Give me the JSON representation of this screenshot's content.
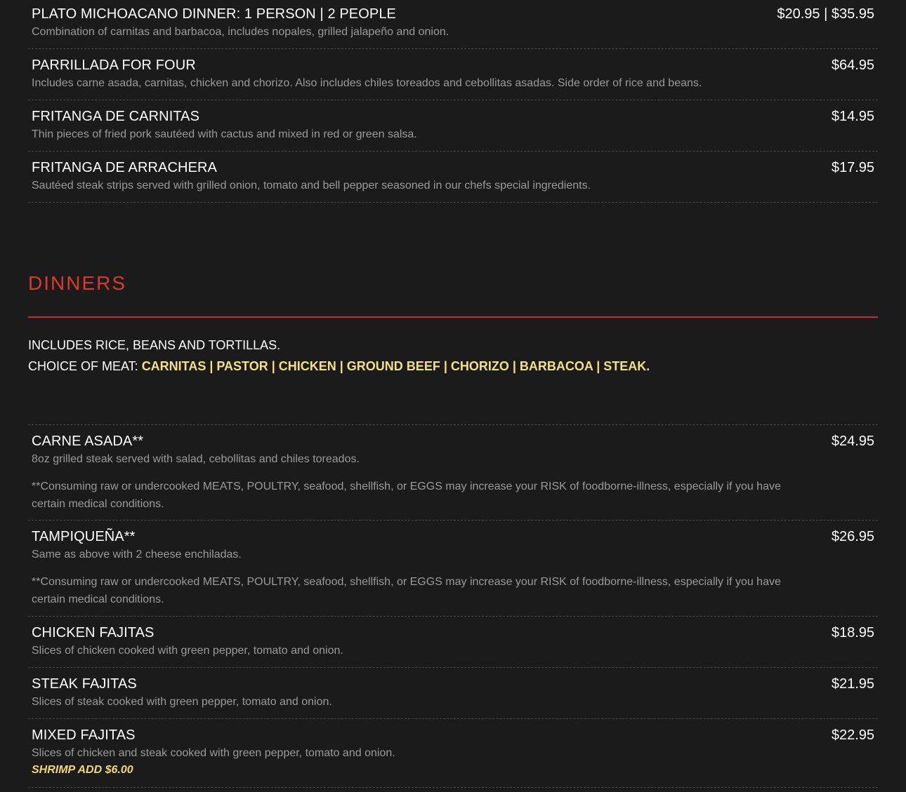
{
  "top_items": [
    {
      "name": "PLATO MICHOACANO DINNER: 1 PERSON | 2 PEOPLE",
      "price": "$20.95 | $35.95",
      "description": "Combination of carnitas and barbacoa, includes nopales, grilled jalapeño and onion."
    },
    {
      "name": "PARRILLADA FOR FOUR",
      "price": "$64.95",
      "description": "Includes carne asada, carnitas, chicken and chorizo. Also includes chiles toreados and cebollitas asadas. Side order of rice and beans."
    },
    {
      "name": "FRITANGA DE CARNITAS",
      "price": "$14.95",
      "description": "Thin pieces of fried pork sautéed with cactus and mixed in red or green salsa."
    },
    {
      "name": "FRITANGA DE ARRACHERA",
      "price": "$17.95",
      "description": "Sautéed steak strips served with grilled onion, tomato and bell pepper seasoned in our chefs special ingredients."
    }
  ],
  "dinners": {
    "title": "DINNERS",
    "includes": "INCLUDES RICE, BEANS AND TORTILLAS.",
    "meat_label": "CHOICE OF MEAT: ",
    "meat_options": "CARNITAS | PASTOR | CHICKEN | GROUND BEEF | CHORIZO | BARBACOA | STEAK.",
    "items": [
      {
        "name": "CARNE ASADA**",
        "price": "$24.95",
        "description": "8oz grilled steak served with salad, cebollitas and chiles toreados.",
        "note": "**Consuming raw or undercooked MEATS, POULTRY, seafood, shellfish, or EGGS may increase your RISK of foodborne-illness, especially if you have certain medical conditions."
      },
      {
        "name": "TAMPIQUEÑA**",
        "price": "$26.95",
        "description": "Same as above with 2 cheese enchiladas.",
        "note": "**Consuming raw or undercooked MEATS, POULTRY, seafood, shellfish, or EGGS may increase your RISK of foodborne-illness, especially if you have certain medical conditions."
      },
      {
        "name": "CHICKEN FAJITAS",
        "price": "$18.95",
        "description": "Slices of chicken cooked with green pepper, tomato and onion."
      },
      {
        "name": "STEAK FAJITAS",
        "price": "$21.95",
        "description": "Slices of steak cooked with green pepper, tomato and onion."
      },
      {
        "name": "MIXED FAJITAS",
        "price": "$22.95",
        "description": "Slices of chicken and steak cooked with green pepper, tomato and onion.",
        "extra": "SHRIMP ADD $6.00"
      }
    ]
  },
  "colors": {
    "background": "#1b1b1c",
    "section_accent": "#d93a2b",
    "highlight_yellow": "#f3e27a",
    "description_gray": "#9a9a9a"
  }
}
